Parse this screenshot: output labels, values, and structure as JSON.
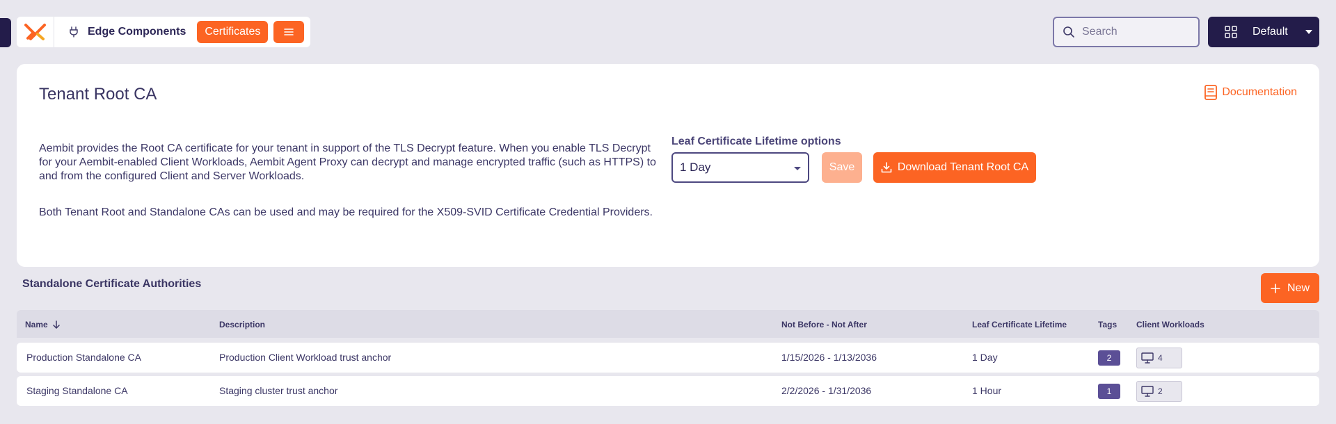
{
  "header": {
    "breadcrumb_label": "Edge Components",
    "active_section": "Certificates",
    "search_placeholder": "Search",
    "workspace_label": "Default"
  },
  "root_ca": {
    "title": "Tenant Root CA",
    "documentation_label": "Documentation",
    "description_1": "Aembit provides the Root CA certificate for your tenant in support of the TLS Decrypt feature. When you enable TLS Decrypt for your Aembit-enabled Client Workloads, Aembit Agent Proxy can decrypt and manage encrypted traffic (such as HTTPS) to and from the configured Client and Server Workloads.",
    "description_2": "Both Tenant Root and Standalone CAs can be used and may be required for the X509-SVID Certificate Credential Providers.",
    "lifetime_label": "Leaf Certificate Lifetime options",
    "lifetime_value": "1 Day",
    "save_label": "Save",
    "download_label": "Download Tenant Root CA"
  },
  "standalone": {
    "title": "Standalone Certificate Authorities",
    "new_label": "New",
    "columns": {
      "name": "Name",
      "description": "Description",
      "validity": "Not Before - Not After",
      "lifetime": "Leaf Certificate Lifetime",
      "tags": "Tags",
      "workloads": "Client Workloads"
    },
    "rows": [
      {
        "name": "Production Standalone CA",
        "description": "Production Client Workload trust anchor",
        "validity": "1/15/2026 - 1/13/2036",
        "lifetime": "1 Day",
        "tags": "2",
        "workloads": "4"
      },
      {
        "name": "Staging Standalone CA",
        "description": "Staging cluster trust anchor",
        "validity": "2/2/2026 - 1/31/2036",
        "lifetime": "1 Hour",
        "tags": "1",
        "workloads": "2"
      }
    ]
  },
  "colors": {
    "accent": "#fc6423",
    "navy": "#231c4a",
    "badge": "#5b4f96"
  }
}
